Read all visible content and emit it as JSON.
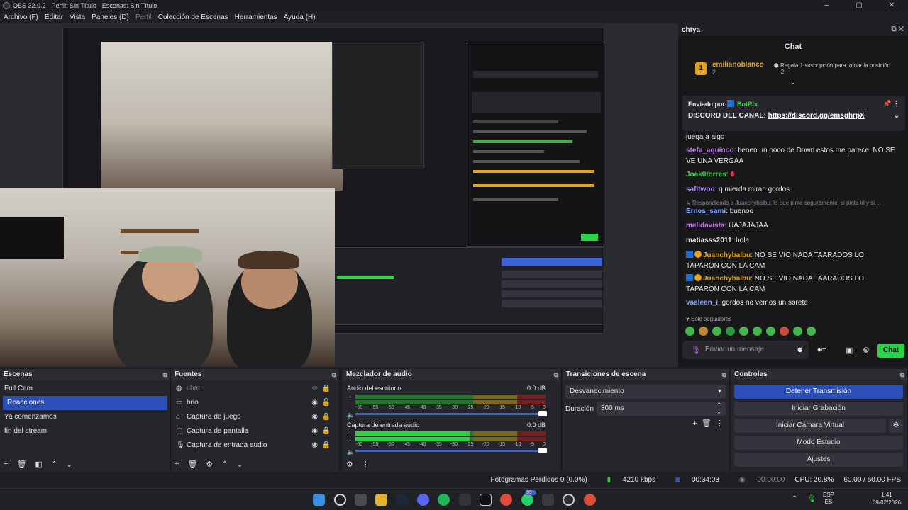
{
  "window": {
    "title": "OBS 32.0.2 - Perfil: Sin Título - Escenas: Sin Título",
    "controls": [
      "–",
      "▢",
      "✕"
    ]
  },
  "menu": {
    "items": [
      "Archivo (F)",
      "Editar",
      "Vista",
      "Paneles (D)",
      "Perfil",
      "Colección de Escenas",
      "Herramientas",
      "Ayuda (H)"
    ],
    "disabled": "Perfil"
  },
  "chat": {
    "dock_title": "chtya",
    "header": "Chat",
    "pinned_user": "emilianoblanco",
    "pinned_count": "2",
    "pinned_action": "Regala 1 suscripción para tomar la posición",
    "pinned_position": "2",
    "announcement": {
      "sent_by": "Enviado por",
      "bot": "BotRix",
      "text": "DISCORD DEL CANAL:",
      "link": "https://discord.gg/emsghrpX"
    },
    "messages": [
      {
        "user": "",
        "text": "juega a algo"
      },
      {
        "user": "stefa_aquinoo",
        "text": ": tienen un poco de Down estos me parece. NO SE VE UNA VERGAA"
      },
      {
        "user": "Joak0torres",
        "text": ":"
      },
      {
        "user": "safitwoo",
        "text": ": q mierda miran gordos"
      },
      {
        "user": "Ernes_sami",
        "text": ": buenoo",
        "reply": "Respondiendo a Juanchybalbu: lo que pinte seguramente, si pinta irl y si ..."
      },
      {
        "user": "melidavista",
        "text": ": UAJAJAJAA"
      },
      {
        "user": "matiasss2011",
        "text": ": hola"
      },
      {
        "user": "Juanchybalbu",
        "text": ": NO SE VIO NADA TAARADOS LO TAPARON CON LA CAM"
      },
      {
        "user": "Juanchybalbu",
        "text": ": NO SE VIO NADA TAARADOS LO TAPARON CON LA CAM"
      },
      {
        "user": "vaaleen_i",
        "text": ": gordos no vemos un sorete"
      }
    ],
    "followers_only": "Solo seguidores",
    "input_placeholder": "Enviar un mensaje",
    "send_label": "Chat",
    "colors": {
      "stefa": "#c07ce8",
      "joak": "#3fd34b",
      "safi": "#a88bf0",
      "ernes": "#7fa7ff",
      "meli": "#c07ce8",
      "matias": "#e6e6e6",
      "juanchy": "#e5a51a",
      "vaaleen": "#7fa7ff",
      "bot": "#3fd34b"
    }
  },
  "scenes": {
    "title": "Escenas",
    "items": [
      "Full Cam",
      "Reacciones",
      "Ya comenzamos",
      "fin del stream"
    ],
    "selected": "Reacciones"
  },
  "sources": {
    "title": "Fuentes",
    "items": [
      {
        "label": "chat",
        "icon": "browser-icon",
        "dim": true
      },
      {
        "label": "brio",
        "icon": "camera-icon"
      },
      {
        "label": "Captura de juego",
        "icon": "gamepad-icon"
      },
      {
        "label": "Captura de pantalla",
        "icon": "monitor-icon"
      },
      {
        "label": "Captura de entrada audio",
        "icon": "mic-icon"
      }
    ]
  },
  "mixer": {
    "title": "Mezclador de audio",
    "channels": [
      {
        "name": "Audio del escritorio",
        "db": "0.0 dB"
      },
      {
        "name": "Captura de entrada audio",
        "db": "0.0 dB"
      }
    ],
    "scale": [
      "-60",
      "-55",
      "-50",
      "-45",
      "-40",
      "-35",
      "-30",
      "-25",
      "-20",
      "-15",
      "-10",
      "-5",
      "0"
    ]
  },
  "transitions": {
    "title": "Transiciones de escena",
    "selected": "Desvanecimiento",
    "duration_label": "Duración",
    "duration_value": "300 ms"
  },
  "controls": {
    "title": "Controles",
    "buttons": [
      "Detener Transmisión",
      "Iniciar Grabación",
      "Iniciar Cámara Virtual",
      "Modo Estudio",
      "Ajustes"
    ]
  },
  "status": {
    "dropped": "Fotogramas Perdidos 0 (0.0%)",
    "bitrate": "4210 kbps",
    "stream_time": "00:34:08",
    "rec_time": "00:00:00",
    "cpu": "CPU: 20.8%",
    "fps": "60.00 / 60.00 FPS"
  },
  "taskbar": {
    "lang_top": "ESP",
    "lang_bottom": "ES",
    "time": "1:41",
    "date": "09/02/2026",
    "badge1": "99+"
  }
}
